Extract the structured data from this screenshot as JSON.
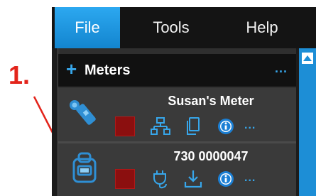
{
  "annotation": {
    "label": "1.",
    "color": "#e3241b"
  },
  "menu": {
    "file": "File",
    "tools": "Tools",
    "help": "Help"
  },
  "meters_panel": {
    "title": "Meters",
    "add_icon": "+",
    "more": "..."
  },
  "meters": [
    {
      "name": "Susan's Meter",
      "device_icon": "sound-level-meter-icon",
      "actions": [
        "stop-square",
        "network-icon",
        "copy-icon",
        "info-icon"
      ],
      "more": "..."
    },
    {
      "name": "730 0000047",
      "device_icon": "dosimeter-icon",
      "actions": [
        "stop-square",
        "usb-plug-icon",
        "download-icon",
        "info-icon"
      ],
      "more": "..."
    }
  ],
  "colors": {
    "accent": "#37a6ea",
    "menu_selected": "#1d8fd8",
    "stop": "#8b0f0f",
    "panel_bg": "#3a3a3a",
    "scrollbar": "#1d8ed6"
  }
}
